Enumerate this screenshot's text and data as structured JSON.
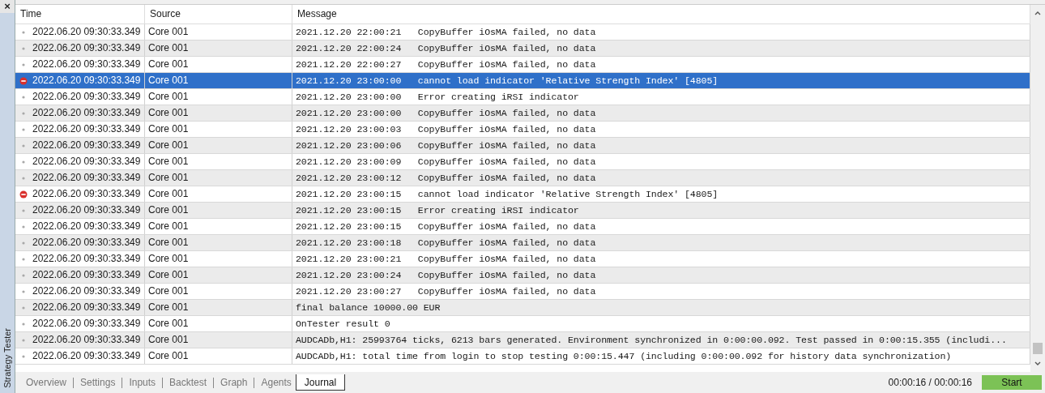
{
  "side_panel": {
    "close": "×",
    "title": "Strategy Tester"
  },
  "table": {
    "columns": [
      "Time",
      "Source",
      "Message"
    ],
    "rows": [
      {
        "kind": "info",
        "selected": false,
        "time": "2022.06.20 09:30:33.349",
        "source": "Core 001",
        "message": "2021.12.20 22:00:21   CopyBuffer iOsMA failed, no data"
      },
      {
        "kind": "info",
        "selected": false,
        "time": "2022.06.20 09:30:33.349",
        "source": "Core 001",
        "message": "2021.12.20 22:00:24   CopyBuffer iOsMA failed, no data"
      },
      {
        "kind": "info",
        "selected": false,
        "time": "2022.06.20 09:30:33.349",
        "source": "Core 001",
        "message": "2021.12.20 22:00:27   CopyBuffer iOsMA failed, no data"
      },
      {
        "kind": "error",
        "selected": true,
        "time": "2022.06.20 09:30:33.349",
        "source": "Core 001",
        "message": "2021.12.20 23:00:00   cannot load indicator 'Relative Strength Index' [4805]"
      },
      {
        "kind": "info",
        "selected": false,
        "time": "2022.06.20 09:30:33.349",
        "source": "Core 001",
        "message": "2021.12.20 23:00:00   Error creating iRSI indicator"
      },
      {
        "kind": "info",
        "selected": false,
        "time": "2022.06.20 09:30:33.349",
        "source": "Core 001",
        "message": "2021.12.20 23:00:00   CopyBuffer iOsMA failed, no data"
      },
      {
        "kind": "info",
        "selected": false,
        "time": "2022.06.20 09:30:33.349",
        "source": "Core 001",
        "message": "2021.12.20 23:00:03   CopyBuffer iOsMA failed, no data"
      },
      {
        "kind": "info",
        "selected": false,
        "time": "2022.06.20 09:30:33.349",
        "source": "Core 001",
        "message": "2021.12.20 23:00:06   CopyBuffer iOsMA failed, no data"
      },
      {
        "kind": "info",
        "selected": false,
        "time": "2022.06.20 09:30:33.349",
        "source": "Core 001",
        "message": "2021.12.20 23:00:09   CopyBuffer iOsMA failed, no data"
      },
      {
        "kind": "info",
        "selected": false,
        "time": "2022.06.20 09:30:33.349",
        "source": "Core 001",
        "message": "2021.12.20 23:00:12   CopyBuffer iOsMA failed, no data"
      },
      {
        "kind": "error",
        "selected": false,
        "time": "2022.06.20 09:30:33.349",
        "source": "Core 001",
        "message": "2021.12.20 23:00:15   cannot load indicator 'Relative Strength Index' [4805]"
      },
      {
        "kind": "info",
        "selected": false,
        "time": "2022.06.20 09:30:33.349",
        "source": "Core 001",
        "message": "2021.12.20 23:00:15   Error creating iRSI indicator"
      },
      {
        "kind": "info",
        "selected": false,
        "time": "2022.06.20 09:30:33.349",
        "source": "Core 001",
        "message": "2021.12.20 23:00:15   CopyBuffer iOsMA failed, no data"
      },
      {
        "kind": "info",
        "selected": false,
        "time": "2022.06.20 09:30:33.349",
        "source": "Core 001",
        "message": "2021.12.20 23:00:18   CopyBuffer iOsMA failed, no data"
      },
      {
        "kind": "info",
        "selected": false,
        "time": "2022.06.20 09:30:33.349",
        "source": "Core 001",
        "message": "2021.12.20 23:00:21   CopyBuffer iOsMA failed, no data"
      },
      {
        "kind": "info",
        "selected": false,
        "time": "2022.06.20 09:30:33.349",
        "source": "Core 001",
        "message": "2021.12.20 23:00:24   CopyBuffer iOsMA failed, no data"
      },
      {
        "kind": "info",
        "selected": false,
        "time": "2022.06.20 09:30:33.349",
        "source": "Core 001",
        "message": "2021.12.20 23:00:27   CopyBuffer iOsMA failed, no data"
      },
      {
        "kind": "info",
        "selected": false,
        "time": "2022.06.20 09:30:33.349",
        "source": "Core 001",
        "message": "final balance 10000.00 EUR"
      },
      {
        "kind": "info",
        "selected": false,
        "time": "2022.06.20 09:30:33.349",
        "source": "Core 001",
        "message": "OnTester result 0"
      },
      {
        "kind": "info",
        "selected": false,
        "time": "2022.06.20 09:30:33.349",
        "source": "Core 001",
        "message": "AUDCADb,H1: 25993764 ticks, 6213 bars generated. Environment synchronized in 0:00:00.092. Test passed in 0:00:15.355 (includi..."
      },
      {
        "kind": "info",
        "selected": false,
        "time": "2022.06.20 09:30:33.349",
        "source": "Core 001",
        "message": "AUDCADb,H1: total time from login to stop testing 0:00:15.447 (including 0:00:00.092 for history data synchronization)"
      }
    ]
  },
  "tabs": [
    {
      "label": "Overview",
      "selected": false
    },
    {
      "label": "Settings",
      "selected": false
    },
    {
      "label": "Inputs",
      "selected": false
    },
    {
      "label": "Backtest",
      "selected": false
    },
    {
      "label": "Graph",
      "selected": false
    },
    {
      "label": "Agents",
      "selected": false
    },
    {
      "label": "Journal",
      "selected": true
    }
  ],
  "status": {
    "elapsed": "00:00:16 / 00:00:16",
    "start_button": "Start"
  }
}
